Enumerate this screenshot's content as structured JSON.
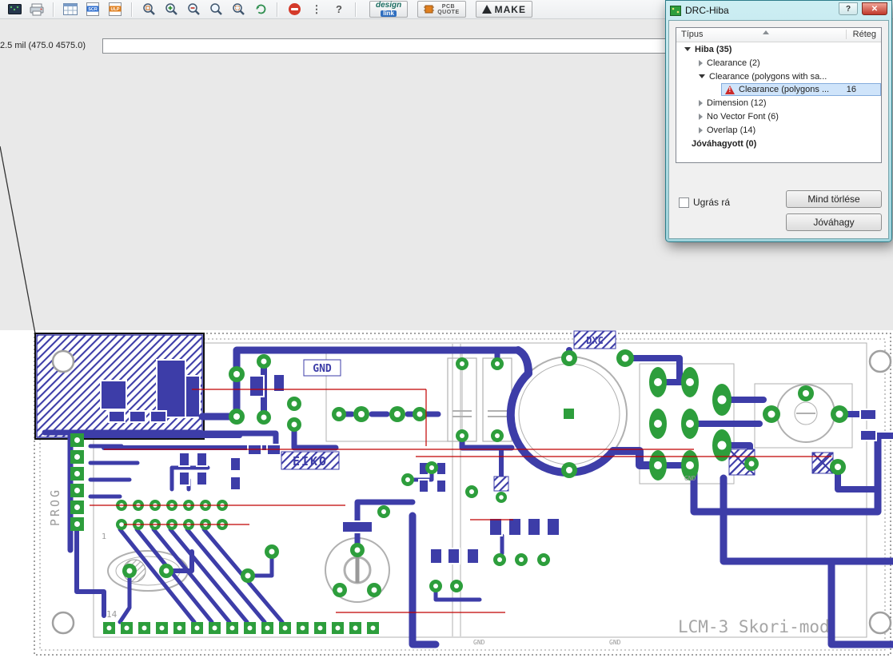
{
  "toolbar": {
    "scr_label": "SCR",
    "ulp_label": "ULP",
    "info_glyph": "⋮",
    "help_glyph": "?",
    "design_link": {
      "line1": "design",
      "line2": "link"
    },
    "pcb_quote": {
      "line1": "PCB",
      "line2": "QUOTE"
    },
    "make": {
      "label": "MAKE"
    }
  },
  "statusbar": {
    "coords": "2.5 mil (475.0 4575.0)"
  },
  "command": {
    "value": ""
  },
  "dialog": {
    "title": "DRC-Hiba",
    "window_buttons": {
      "help": "?",
      "close": "✕"
    },
    "columns": {
      "type": "Típus",
      "layer": "Réteg"
    },
    "tree": [
      {
        "label": "Hiba (35)"
      },
      {
        "label": "Clearance (2)"
      },
      {
        "label": "Clearance (polygons with sa..."
      },
      {
        "label": "Clearance (polygons ...",
        "layer": "16"
      },
      {
        "label": "Dimension (12)"
      },
      {
        "label": "No Vector Font (6)"
      },
      {
        "label": "Overlap (14)"
      },
      {
        "label": "Jóváhagyott (0)"
      }
    ],
    "checkbox_label": "Ugrás rá",
    "buttons": {
      "clear_all": "Mind törlése",
      "approve": "Jóváhagy"
    }
  },
  "board": {
    "labels": {
      "gnd_box": "GND",
      "eiko": "EIKO",
      "dxc": "DXC",
      "prog": "PROG",
      "pin1": "1",
      "pin14": "14",
      "gnd_small": "GND",
      "title": "LCM-3 Skori-mod"
    },
    "colors": {
      "trace": "#3d3da8",
      "pad": "#2d9e3c",
      "airwire": "#c00000",
      "silk": "#b0b0b0"
    }
  }
}
